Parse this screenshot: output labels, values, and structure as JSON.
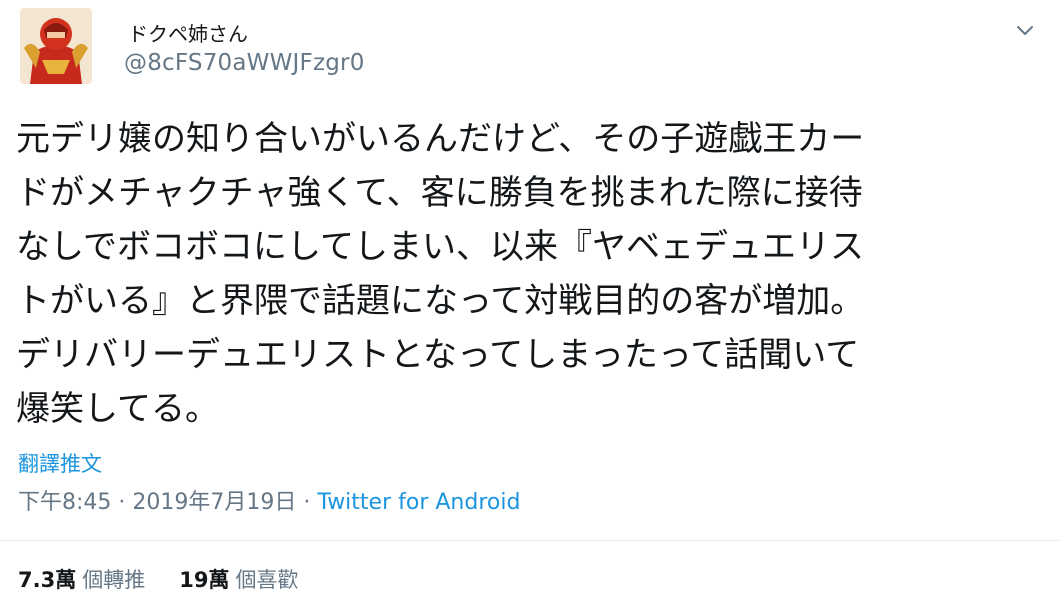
{
  "user": {
    "display_name": "ドクペ姉さん",
    "handle": "@8cFS70aWWJFzgr0"
  },
  "tweet": {
    "text": "元デリ嬢の知り合いがいるんだけど、その子遊戯王カー\nドがメチャクチャ強くて、客に勝負を挑まれた際に接待\nなしでボコボコにしてしまい、以来『ヤベェデュエリス\nトがいる』と界隈で話題になって対戦目的の客が増加。\nデリバリーデュエリストとなってしまったって話聞いて\n爆笑してる。",
    "translate_label": "翻譯推文",
    "time": "下午8:45",
    "separator": "·",
    "date": "2019年7月19日",
    "source": "Twitter for Android"
  },
  "stats": {
    "retweets_count": "7.3萬",
    "retweets_label": "個轉推",
    "likes_count": "19萬",
    "likes_label": "個喜歡"
  },
  "icons": {
    "avatar": "avatar-image",
    "menu": "chevron-down-icon"
  },
  "colors": {
    "link": "#1b95e0",
    "secondary": "#657786",
    "text": "#14171a"
  }
}
